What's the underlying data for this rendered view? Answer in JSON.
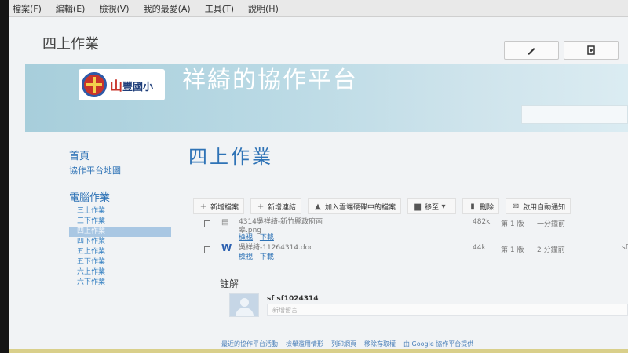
{
  "menu": [
    "檔案(F)",
    "編輯(E)",
    "檢視(V)",
    "我的最愛(A)",
    "工具(T)",
    "說明(H)"
  ],
  "site": {
    "title": "四上作業",
    "logo_mtn": "山",
    "logo_name": "豐國小",
    "banner_title": "祥綺的協作平台"
  },
  "sidebar": {
    "home": "首頁",
    "sitemap": "協作平台地圖",
    "section": "電腦作業",
    "items": [
      "三上作業",
      "三下作業",
      "四上作業",
      "四下作業",
      "五上作業",
      "五下作業",
      "六上作業",
      "六下作業"
    ]
  },
  "page": {
    "title": "四上作業"
  },
  "toolbar": {
    "add_file": "新增檔案",
    "add_link": "新增連結",
    "add_drive": "加入雲端硬碟中的檔案",
    "move": "移至",
    "delete": "刪除",
    "subscribe": "啟用自動通知"
  },
  "files": [
    {
      "name": "4314吳祥綺-新竹縣政府南皋.png",
      "size": "482k",
      "version": "第 1 版",
      "date": "一分鐘前",
      "links": [
        "檢視",
        "下載"
      ]
    },
    {
      "name": "吳祥綺-11264314.doc",
      "size": "44k",
      "version": "第 1 版",
      "date": "2 分鐘前",
      "links": [
        "檢視",
        "下載"
      ],
      "right": "sf"
    }
  ],
  "comments": {
    "title": "註解",
    "user": "sf sf1024314",
    "placeholder": "新增留言"
  },
  "footer": [
    "最近的協作平台活動",
    "檢舉濫用情形",
    "列印網頁",
    "移除存取權",
    "由 Google 協作平台提供"
  ],
  "colors": {
    "link": "#2f73b6",
    "banner": "#a7cedb"
  }
}
